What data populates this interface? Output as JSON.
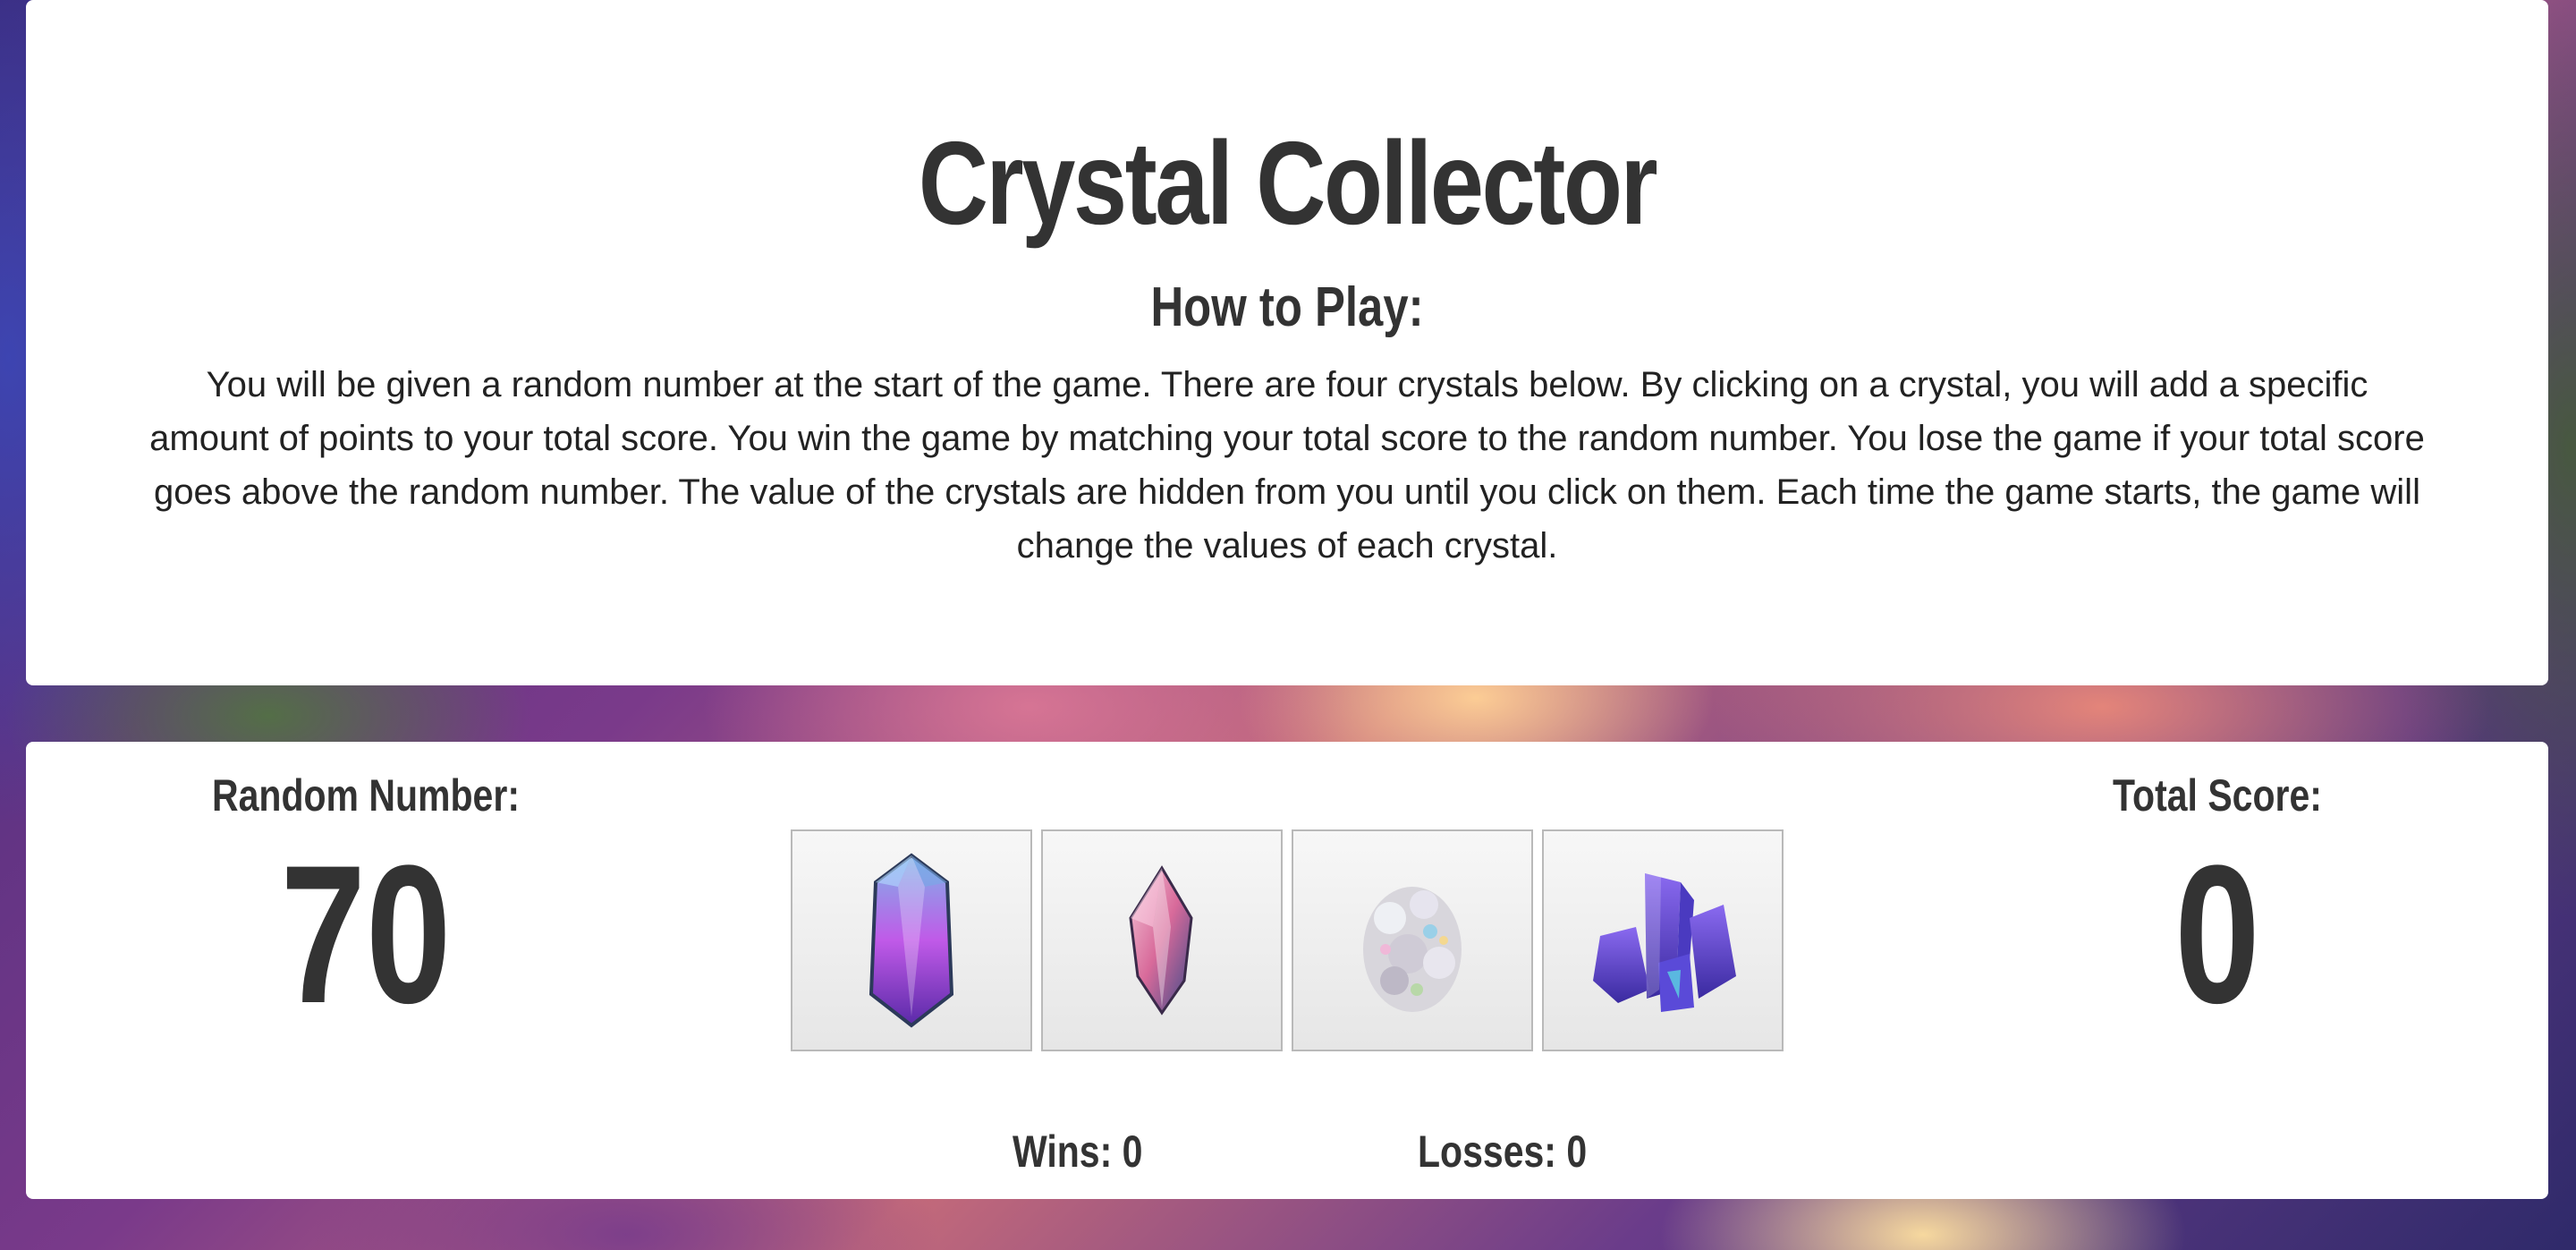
{
  "header": {
    "title": "Crystal Collector",
    "how_heading": "How to Play:",
    "instructions": "You will be given a random number at the start of the game. There are four crystals below. By clicking on a crystal, you will add a specific amount of points to your total score. You win the game by matching your total score to the random number. You lose the game if your total score goes above the random number. The value of the crystals are hidden from you until you click on them. Each time the game starts, the game will change the values of each crystal."
  },
  "game": {
    "random_label": "Random Number:",
    "random_value": "70",
    "total_label": "Total Score:",
    "total_value": "0",
    "wins_label": "Wins: 0",
    "losses_label": "Losses: 0",
    "crystals": [
      {
        "icon": "purple-crystal-icon",
        "color": "#b25ce8"
      },
      {
        "icon": "pink-crystal-icon",
        "color": "#e07aa8"
      },
      {
        "icon": "white-geode-crystal-icon",
        "color": "#d8d8e0"
      },
      {
        "icon": "violet-cluster-crystal-icon",
        "color": "#6a4ad8"
      }
    ]
  },
  "colors": {
    "text": "#333333",
    "panel": "#ffffff"
  }
}
